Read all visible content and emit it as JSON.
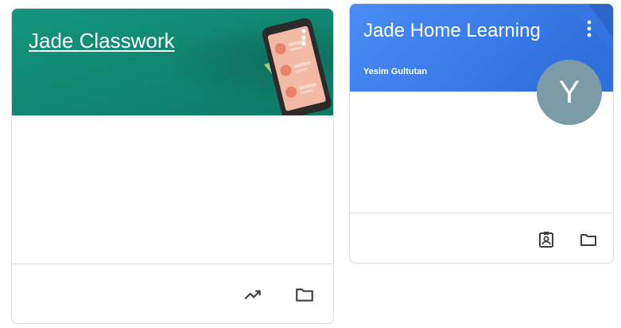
{
  "colors": {
    "classwork_banner": "#0e8a74",
    "home_learning_banner": "#4285f4",
    "avatar_bg": "#7b9ba6",
    "icon_color": "#3c4043"
  },
  "cards": [
    {
      "title": "Jade Classwork",
      "subtitle": "",
      "footer_icons": [
        "trending-up-icon",
        "folder-icon"
      ]
    },
    {
      "title": "Jade Home Learning",
      "subtitle": "Yesim Gultutan",
      "avatar_letter": "Y",
      "footer_icons": [
        "gradebook-icon",
        "folder-icon"
      ]
    }
  ]
}
